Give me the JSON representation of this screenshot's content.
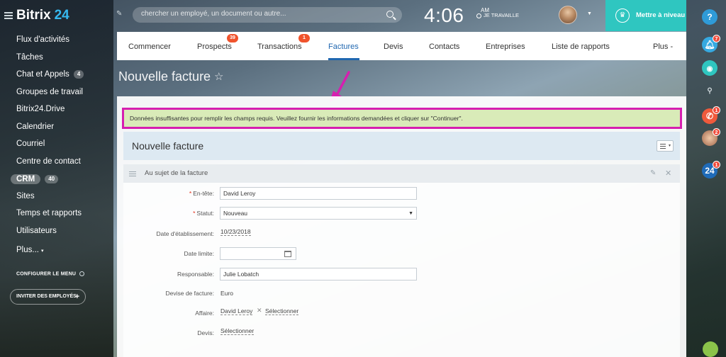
{
  "sidebar": {
    "logo": "Bitrix",
    "logo_num": "24",
    "items": [
      {
        "label": "Flux d'activités",
        "badge": ""
      },
      {
        "label": "Tâches",
        "badge": ""
      },
      {
        "label": "Chat et Appels",
        "badge": "4"
      },
      {
        "label": "Groupes de travail",
        "badge": ""
      },
      {
        "label": "Bitrix24.Drive",
        "badge": ""
      },
      {
        "label": "Calendrier",
        "badge": ""
      },
      {
        "label": "Courriel",
        "badge": ""
      },
      {
        "label": "Centre de contact",
        "badge": ""
      },
      {
        "label": "CRM",
        "badge": "40"
      },
      {
        "label": "Sites",
        "badge": ""
      },
      {
        "label": "Temps et rapports",
        "badge": ""
      },
      {
        "label": "Utilisateurs",
        "badge": ""
      },
      {
        "label": "Plus...",
        "badge": ""
      }
    ],
    "configure_menu": "CONFIGURER LE MENU",
    "invite_button": "INVITER DES EMPLOYÉS"
  },
  "topbar": {
    "search_placeholder": "chercher un employé, un document ou autre...",
    "time": "4:06",
    "ampm": "AM",
    "work_status": "JE TRAVAILLE",
    "upgrade_label": "Mettre à niveau"
  },
  "tabs": [
    {
      "label": "Commencer",
      "badge": ""
    },
    {
      "label": "Prospects",
      "badge": "39"
    },
    {
      "label": "Transactions",
      "badge": "1"
    },
    {
      "label": "Factures",
      "badge": ""
    },
    {
      "label": "Devis",
      "badge": ""
    },
    {
      "label": "Contacts",
      "badge": ""
    },
    {
      "label": "Entreprises",
      "badge": ""
    },
    {
      "label": "Liste de rapports",
      "badge": ""
    },
    {
      "label": "Plus -",
      "badge": ""
    }
  ],
  "active_tab": "Factures",
  "page": {
    "title": "Nouvelle facture",
    "alert": "Données insuffisantes pour remplir les champs requis. Veuillez fournir les informations demandées et cliquer sur \"Continuer\".",
    "form_title": "Nouvelle facture",
    "section_title": "Au sujet de la facture"
  },
  "form": {
    "header_label": "En-tête:",
    "header_value": "David Leroy",
    "status_label": "Statut:",
    "status_value": "Nouveau",
    "issue_date_label": "Date d'établissement:",
    "issue_date_value": "10/23/2018",
    "due_date_label": "Date limite:",
    "due_date_value": "",
    "responsible_label": "Responsable:",
    "responsible_value": "Julie Lobatch",
    "currency_label": "Devise de facture:",
    "currency_value": "Euro",
    "deal_label": "Affaire:",
    "deal_value": "David Leroy",
    "deal_select": "Sélectionner",
    "quote_label": "Devis:",
    "quote_select": "Sélectionner"
  },
  "right_rail": {
    "help": "?",
    "notif_badge": "7",
    "phone_badge": "1",
    "contact_badge": "2",
    "b24_label": "24",
    "b24_badge": "1"
  },
  "colors": {
    "accent": "#2067b0",
    "highlight_frame": "#d61fb0",
    "alert_bg": "#d9ebb8",
    "upgrade_bg": "#2fc6c0"
  }
}
